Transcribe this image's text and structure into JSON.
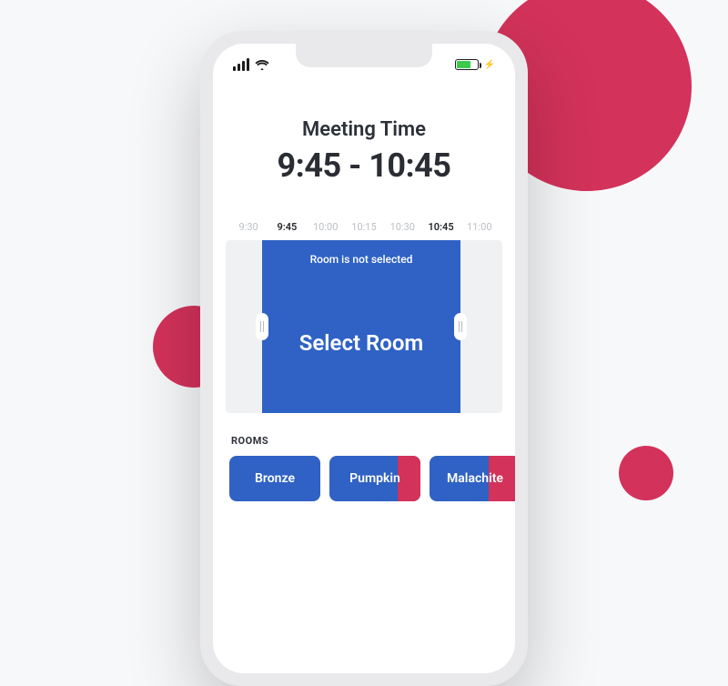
{
  "header": {
    "title": "Meeting Time",
    "time_range": "9:45 - 10:45"
  },
  "ruler": {
    "ticks": [
      {
        "label": "9:30",
        "active": false
      },
      {
        "label": "9:45",
        "active": true
      },
      {
        "label": "10:00",
        "active": false
      },
      {
        "label": "10:15",
        "active": false
      },
      {
        "label": "10:30",
        "active": false
      },
      {
        "label": "10:45",
        "active": true
      },
      {
        "label": "11:00",
        "active": false
      }
    ]
  },
  "slot": {
    "status_text": "Room is not selected",
    "action_label": "Select Room"
  },
  "rooms": {
    "section_label": "ROOMS",
    "items": [
      {
        "name": "Bronze",
        "busy_pct": 0
      },
      {
        "name": "Pumpkin",
        "busy_pct": 25
      },
      {
        "name": "Malachite",
        "busy_pct": 35
      }
    ]
  }
}
